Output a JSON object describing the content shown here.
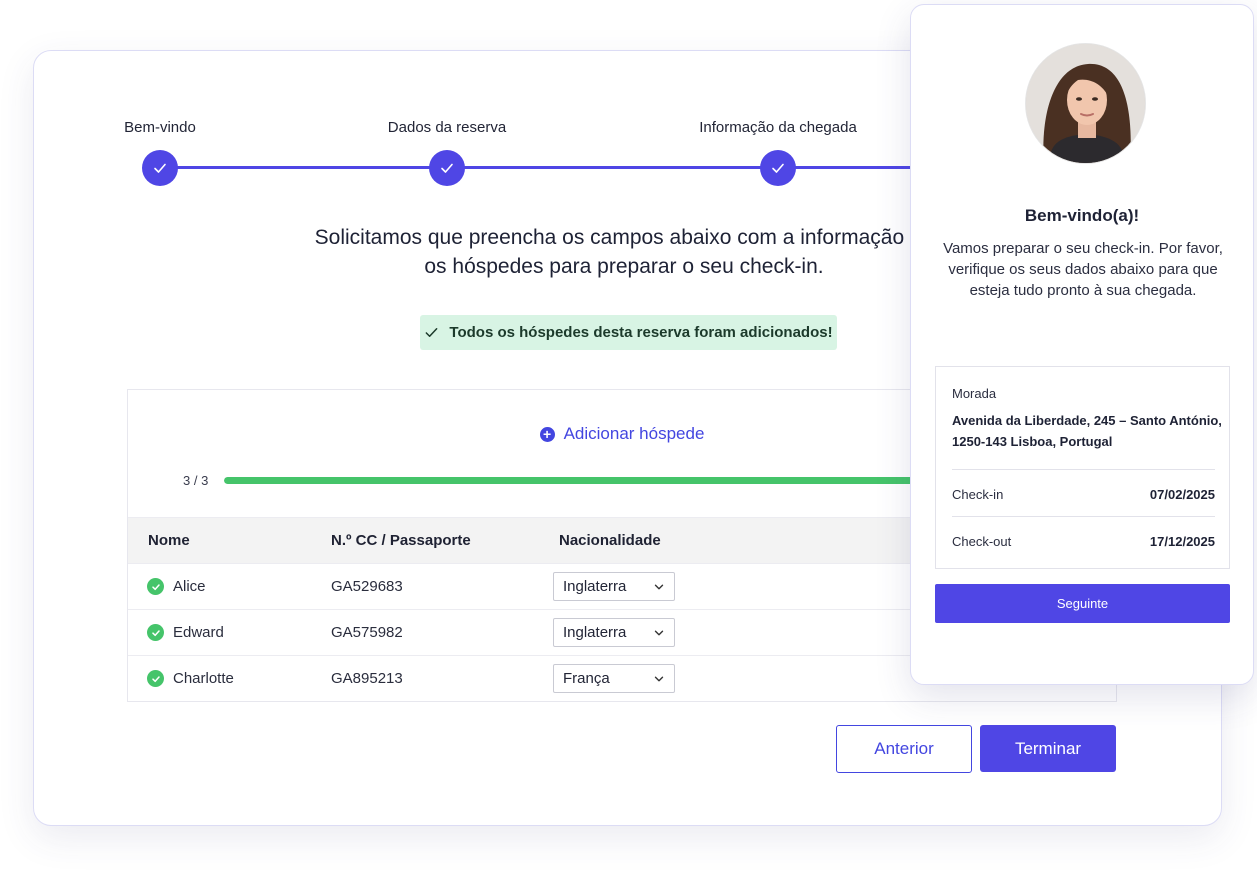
{
  "stepper": {
    "steps": [
      {
        "label": "Bem-vindo"
      },
      {
        "label": "Dados da reserva"
      },
      {
        "label": "Informação da chegada"
      }
    ]
  },
  "intro": {
    "line1": "Solicitamos que preencha os campos abaixo com a informação de",
    "line2": "os hóspedes para preparar o seu check-in."
  },
  "alert": {
    "text": "Todos os hóspedes desta reserva foram adicionados!"
  },
  "guests": {
    "add_label": "Adicionar hóspede",
    "progress_text": "3 / 3",
    "progress_fraction": 1.0,
    "columns": [
      "Nome",
      "N.º CC / Passaporte",
      "Nacionalidade"
    ],
    "rows": [
      {
        "name": "Alice",
        "document": "GA529683",
        "nationality": "Inglaterra"
      },
      {
        "name": "Edward",
        "document": "GA575982",
        "nationality": "Inglaterra"
      },
      {
        "name": "Charlotte",
        "document": "GA895213",
        "nationality": "França"
      }
    ]
  },
  "actions": {
    "previous": "Anterior",
    "finish": "Terminar"
  },
  "panel": {
    "title": "Bem-vindo(a)!",
    "text": "Vamos preparar o seu check-in. Por favor, verifique os seus dados abaixo para que esteja tudo pronto à sua chegada.",
    "address_label": "Morada",
    "address_line1": "Avenida da Liberdade, 245 – Santo António,",
    "address_line2": "1250-143 Lisboa, Portugal",
    "checkin_label": "Check-in",
    "checkin_value": "07/02/2025",
    "checkout_label": "Check-out",
    "checkout_value": "17/12/2025",
    "next": "Seguinte"
  },
  "colors": {
    "accent": "#4f46e5",
    "success": "#45c46a",
    "alert_bg": "#d8f4e4"
  }
}
